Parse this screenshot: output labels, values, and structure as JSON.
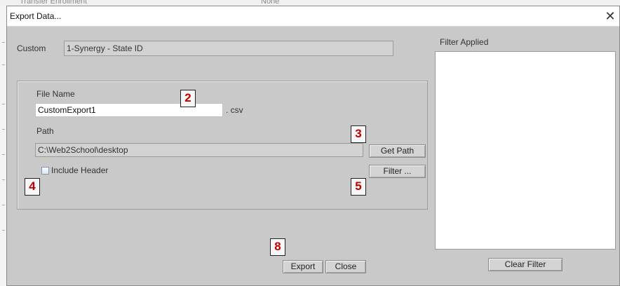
{
  "window": {
    "title": "Export Data...",
    "close_glyph": "✕"
  },
  "custom": {
    "label": "Custom",
    "value": "1-Synergy - State ID"
  },
  "file": {
    "name_label": "File Name",
    "name_value": "CustomExport1",
    "extension": ". csv",
    "path_label": "Path",
    "path_value": "C:\\Web2School\\desktop",
    "get_path_label": "Get Path",
    "include_header_label": "Include Header",
    "include_header_checked": false,
    "filter_label": "Filter ..."
  },
  "filter_panel": {
    "label": "Filter Applied",
    "clear_label": "Clear Filter"
  },
  "actions": {
    "export_label": "Export",
    "close_label": "Close"
  },
  "callouts": [
    "2",
    "3",
    "4",
    "5",
    "8"
  ],
  "background_text": {
    "left": "Transfer Enrollment",
    "mid": "None"
  }
}
